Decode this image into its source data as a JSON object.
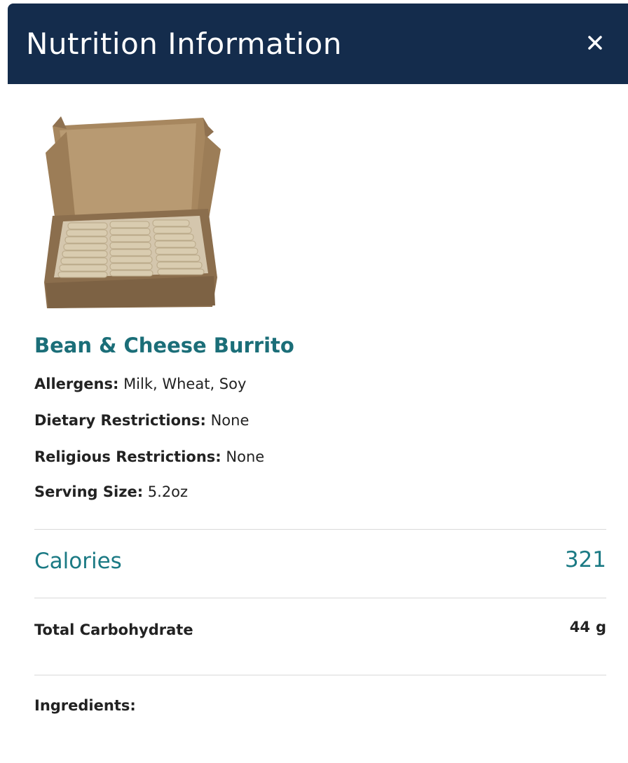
{
  "header": {
    "title": "Nutrition Information",
    "close_icon": "close-icon",
    "background_color": "#142c4c"
  },
  "product": {
    "image_icon": "burrito-box-image",
    "name": "Bean & Cheese Burrito",
    "accent_color": "#1b6e78"
  },
  "details": [
    {
      "label": "Allergens:",
      "value": "Milk, Wheat, Soy"
    },
    {
      "label": "Dietary Restrictions:",
      "value": "None"
    },
    {
      "label": "Religious Restrictions:",
      "value": "None"
    },
    {
      "label": "Serving Size:",
      "value": "5.2oz"
    }
  ],
  "calories": {
    "label": "Calories",
    "value": "321"
  },
  "nutrients": [
    {
      "label": "Total Carbohydrate",
      "value": "44",
      "unit": "g"
    }
  ],
  "ingredients": {
    "label": "Ingredients:"
  }
}
